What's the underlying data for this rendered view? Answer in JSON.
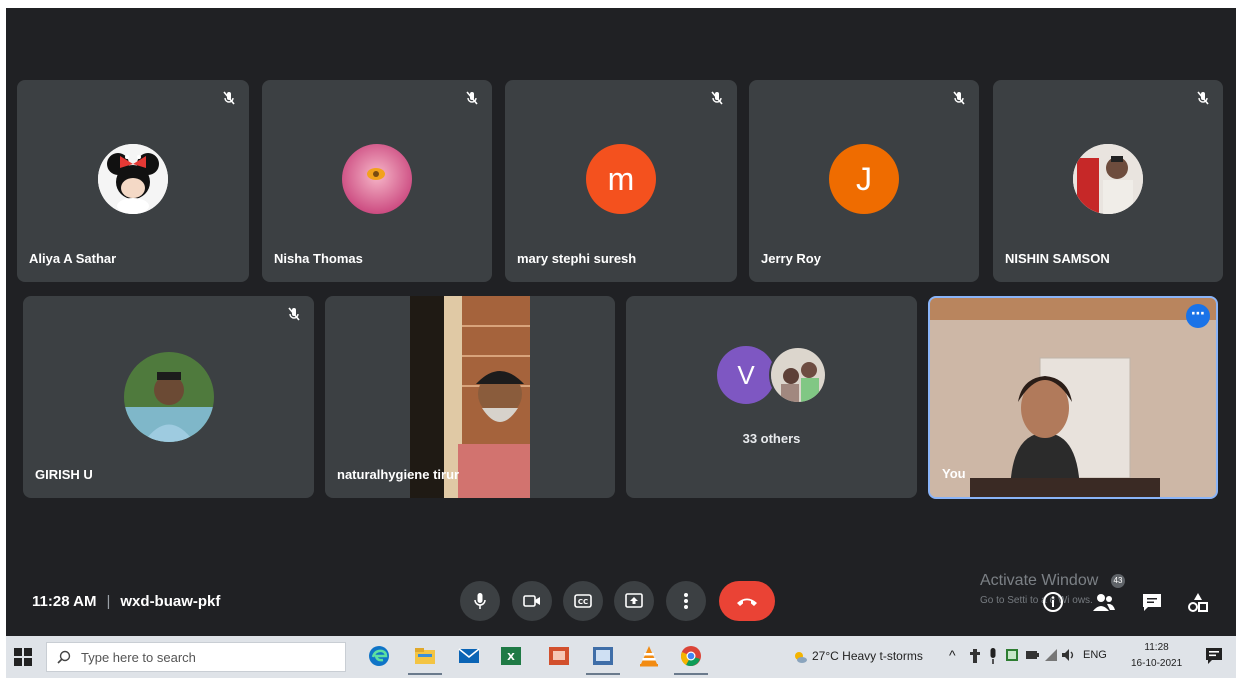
{
  "meeting": {
    "time": "11:28 AM",
    "separator": "|",
    "code": "wxd-buaw-pkf"
  },
  "participants_row1": [
    {
      "name": "Aliya A Sathar",
      "avatar": "minnie-mouse-photo",
      "muted": true
    },
    {
      "name": "Nisha Thomas",
      "avatar": "flower-photo",
      "muted": true
    },
    {
      "name": "mary stephi suresh",
      "avatar_letter": "m",
      "avatar_color": "#f4511e",
      "muted": true
    },
    {
      "name": "Jerry Roy",
      "avatar_letter": "J",
      "avatar_color": "#ef6c00",
      "muted": true
    },
    {
      "name": "NISHIN SAMSON",
      "avatar": "person-photo",
      "muted": true
    }
  ],
  "participants_row2": [
    {
      "name": "GIRISH U",
      "avatar": "person-photo",
      "muted": true
    },
    {
      "name": "naturalhygiene tirur",
      "video": true,
      "muted": false
    },
    {
      "others_letter": "V",
      "others_color": "#7e57c2",
      "others_label": "33 others"
    },
    {
      "name": "You",
      "video": true,
      "self": true
    }
  ],
  "controls": [
    {
      "name": "microphone",
      "icon": "mic-icon"
    },
    {
      "name": "camera",
      "icon": "camera-icon"
    },
    {
      "name": "captions",
      "icon": "cc-icon"
    },
    {
      "name": "present",
      "icon": "present-icon"
    },
    {
      "name": "more options",
      "icon": "more-vert-icon"
    },
    {
      "name": "leave call",
      "icon": "call-end-icon"
    }
  ],
  "right_panel": {
    "people_count": "43",
    "icons": [
      "info-icon",
      "people-icon",
      "chat-icon",
      "activities-icon"
    ]
  },
  "watermark": {
    "title": "Activate Window",
    "subtitle": "Go to Setti      to a        e Wi    ows."
  },
  "taskbar": {
    "search_placeholder": "Type here to search",
    "apps": [
      "edge-icon",
      "file-explorer-icon",
      "mail-icon",
      "excel-icon",
      "powerpoint-icon",
      "vlc-alt-icon",
      "vlc-icon",
      "chrome-icon"
    ],
    "weather": "27°C  Heavy t-storms",
    "tray_chevron": "^",
    "language": "ENG",
    "clock_time": "11:28",
    "clock_date": "16-10-2021"
  },
  "colors": {
    "meet_bg": "#202124",
    "tile_bg": "#3c4043",
    "end_call": "#ea4335",
    "self_border": "#8ab4f8",
    "more_button": "#1a73e8"
  }
}
